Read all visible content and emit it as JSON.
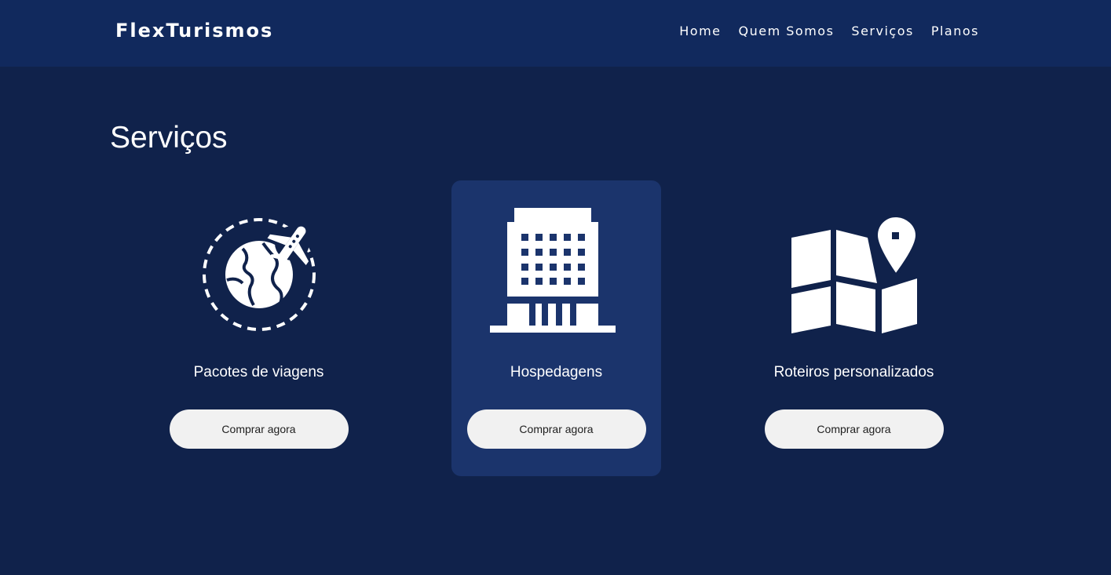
{
  "header": {
    "brand": "FlexTurismos",
    "nav": [
      "Home",
      "Quem Somos",
      "Serviços",
      "Planos"
    ]
  },
  "main": {
    "title": "Serviços",
    "cards": [
      {
        "icon": "globe-airplane-icon",
        "label": "Pacotes de viagens",
        "button": "Comprar agora"
      },
      {
        "icon": "hotel-building-icon",
        "label": "Hospedagens",
        "button": "Comprar agora"
      },
      {
        "icon": "map-pin-icon",
        "label": "Roteiros personalizados",
        "button": "Comprar agora"
      }
    ]
  },
  "colors": {
    "background": "#10224b",
    "header": "#11295d",
    "featured_card": "#1b346c",
    "button": "#f1f1f1"
  }
}
